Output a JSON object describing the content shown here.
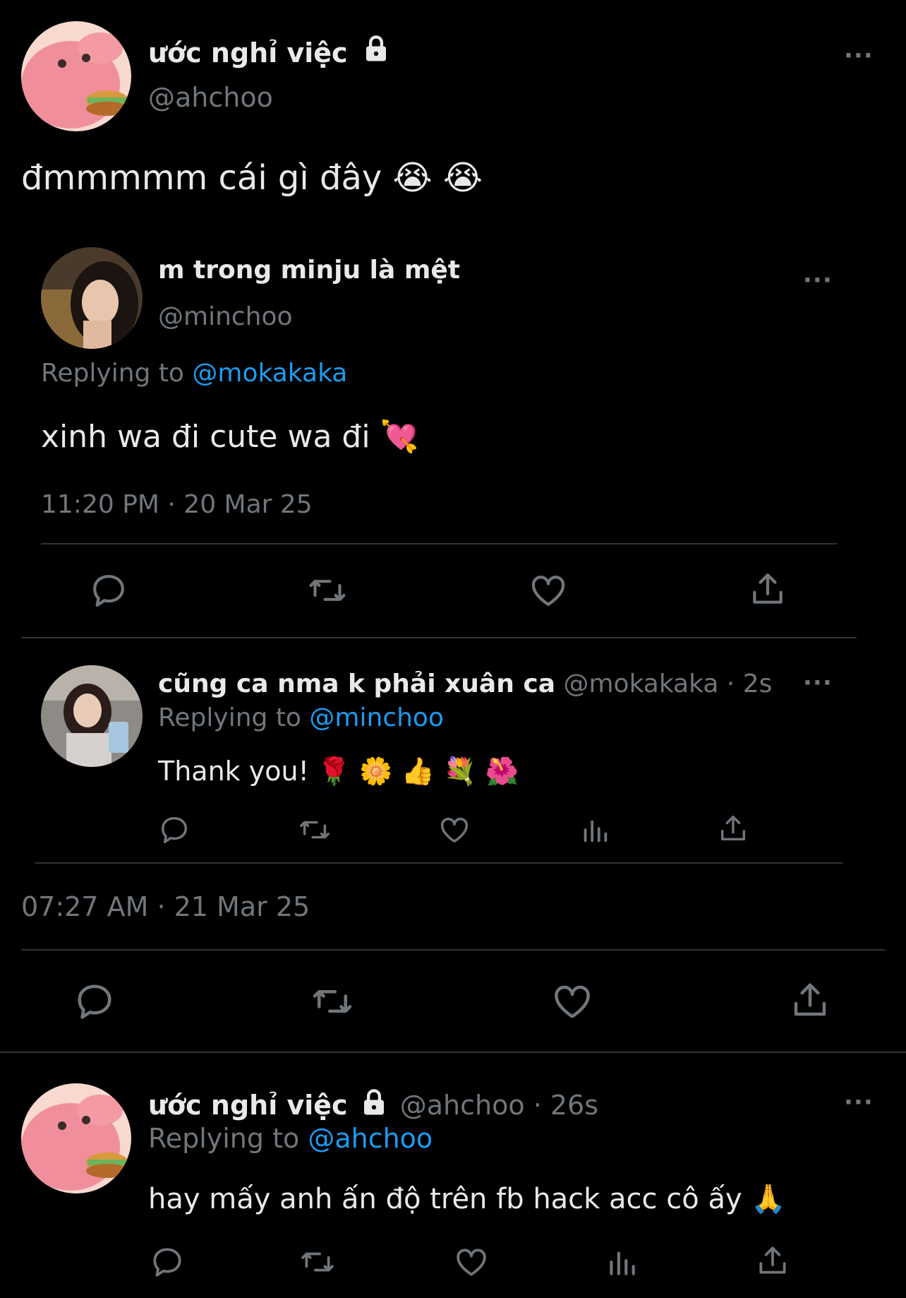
{
  "main_tweet": {
    "display_name": "ước nghỉ việc",
    "handle": "@ahchoo",
    "text": "đmmmmm cái gì đây 😭 😭",
    "timestamp": "07:27 AM · 21 Mar 25",
    "more_label": "···"
  },
  "quoted_tweet": {
    "display_name": "m trong minju là mệt",
    "handle": "@minchoo",
    "replying_prefix": "Replying to",
    "replying_to": "@mokakaka",
    "text": "xinh wa đi cute wa đi 💘",
    "timestamp": "11:20 PM · 20 Mar 25",
    "more_label": "···"
  },
  "quoted_reply": {
    "display_name": "cũng ca nma k phải xuân ca",
    "handle": "@mokakaka",
    "time_ago": "· 2s",
    "replying_prefix": "Replying to",
    "replying_to": "@minchoo",
    "text": "Thank you! 🌹 🌼 👍 💐 🌺",
    "more_label": "···"
  },
  "reply": {
    "display_name": "ước nghỉ việc",
    "handle": "@ahchoo",
    "time_ago": "· 26s",
    "replying_prefix": "Replying to",
    "replying_to": "@ahchoo",
    "text": "hay mấy anh ấn độ trên fb hack acc cô ấy 🙏",
    "more_label": "···"
  },
  "icons": [
    "reply-icon",
    "retweet-icon",
    "like-icon",
    "views-icon",
    "share-icon",
    "lock-icon",
    "more-icon"
  ],
  "colors": {
    "background": "#000000",
    "text": "#e7e9ea",
    "muted": "#71767b",
    "link": "#1d9bf0",
    "divider": "#2f3336"
  }
}
